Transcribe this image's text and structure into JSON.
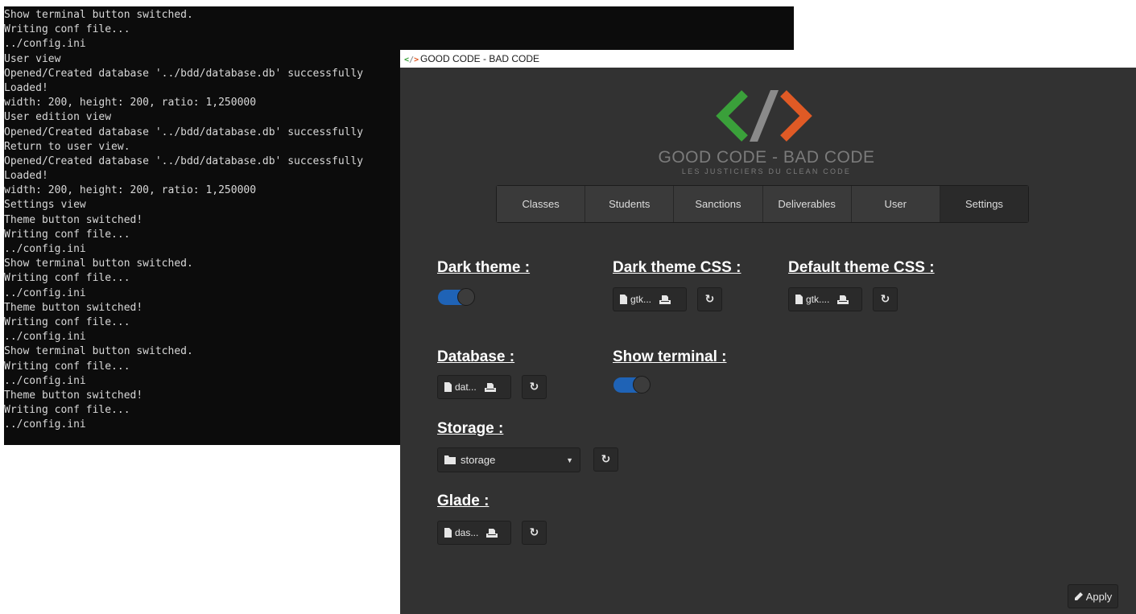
{
  "terminal": {
    "lines": [
      "Show terminal button switched.",
      "Writing conf file...",
      "../config.ini",
      "User view",
      "Opened/Created database '../bdd/database.db' successfully",
      "Loaded!",
      "width: 200, height: 200, ratio: 1,250000",
      "User edition view",
      "Opened/Created database '../bdd/database.db' successfully",
      "Return to user view.",
      "Opened/Created database '../bdd/database.db' successfully",
      "Loaded!",
      "width: 200, height: 200, ratio: 1,250000",
      "Settings view",
      "Theme button switched!",
      "Writing conf file...",
      "../config.ini",
      "Show terminal button switched.",
      "Writing conf file...",
      "../config.ini",
      "Theme button switched!",
      "Writing conf file...",
      "../config.ini",
      "Show terminal button switched.",
      "Writing conf file...",
      "../config.ini",
      "Theme button switched!",
      "Writing conf file...",
      "../config.ini"
    ]
  },
  "window": {
    "title": "GOOD CODE - BAD CODE",
    "icon": "code-brackets-icon"
  },
  "brand": {
    "name": "GOOD CODE - BAD CODE",
    "tagline": "LES JUSTICIERS DU CLEAN CODE",
    "colors": {
      "left": "#3aa03a",
      "slash": "#8a8a8a",
      "right": "#e05a25"
    }
  },
  "tabs": [
    {
      "label": "Classes",
      "active": false
    },
    {
      "label": "Students",
      "active": false
    },
    {
      "label": "Sanctions",
      "active": false
    },
    {
      "label": "Deliverables",
      "active": false
    },
    {
      "label": "User",
      "active": false
    },
    {
      "label": "Settings",
      "active": true
    }
  ],
  "settings": {
    "dark_theme": {
      "label": "Dark theme :",
      "enabled": true
    },
    "dark_theme_css": {
      "label": "Dark theme CSS :",
      "file": "gtk..."
    },
    "default_theme_css": {
      "label": "Default theme CSS :",
      "file": "gtk...."
    },
    "database": {
      "label": "Database :",
      "file": "dat..."
    },
    "show_terminal": {
      "label": "Show terminal :",
      "enabled": true
    },
    "storage": {
      "label": "Storage :",
      "value": "storage"
    },
    "glade": {
      "label": "Glade :",
      "file": "das..."
    },
    "apply_label": "Apply"
  },
  "colors": {
    "window_bg": "#323232",
    "toggle_on": "#1f63b6",
    "terminal_bg": "#0c0c0c"
  }
}
